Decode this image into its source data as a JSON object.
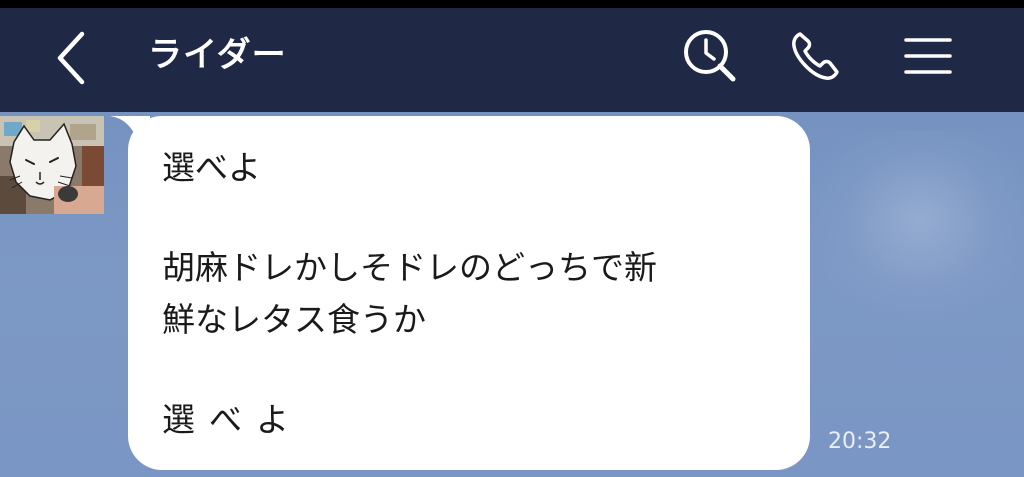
{
  "header": {
    "title": "ライダー",
    "icons": {
      "back": "chevron-left-icon",
      "search": "search-clock-icon",
      "call": "phone-icon",
      "menu": "menu-icon"
    }
  },
  "conversation": {
    "message": {
      "lines": [
        "選べよ",
        "胡麻ドレかしそドレのどっちで新",
        "鮮なレタス食うか",
        "選べよ"
      ],
      "time": "20:32"
    }
  },
  "colors": {
    "header_bg": "#1f2946",
    "background": "#7693c0",
    "bubble": "#ffffff",
    "text": "#1a1a1a",
    "timestamp": "#e9eef8"
  }
}
